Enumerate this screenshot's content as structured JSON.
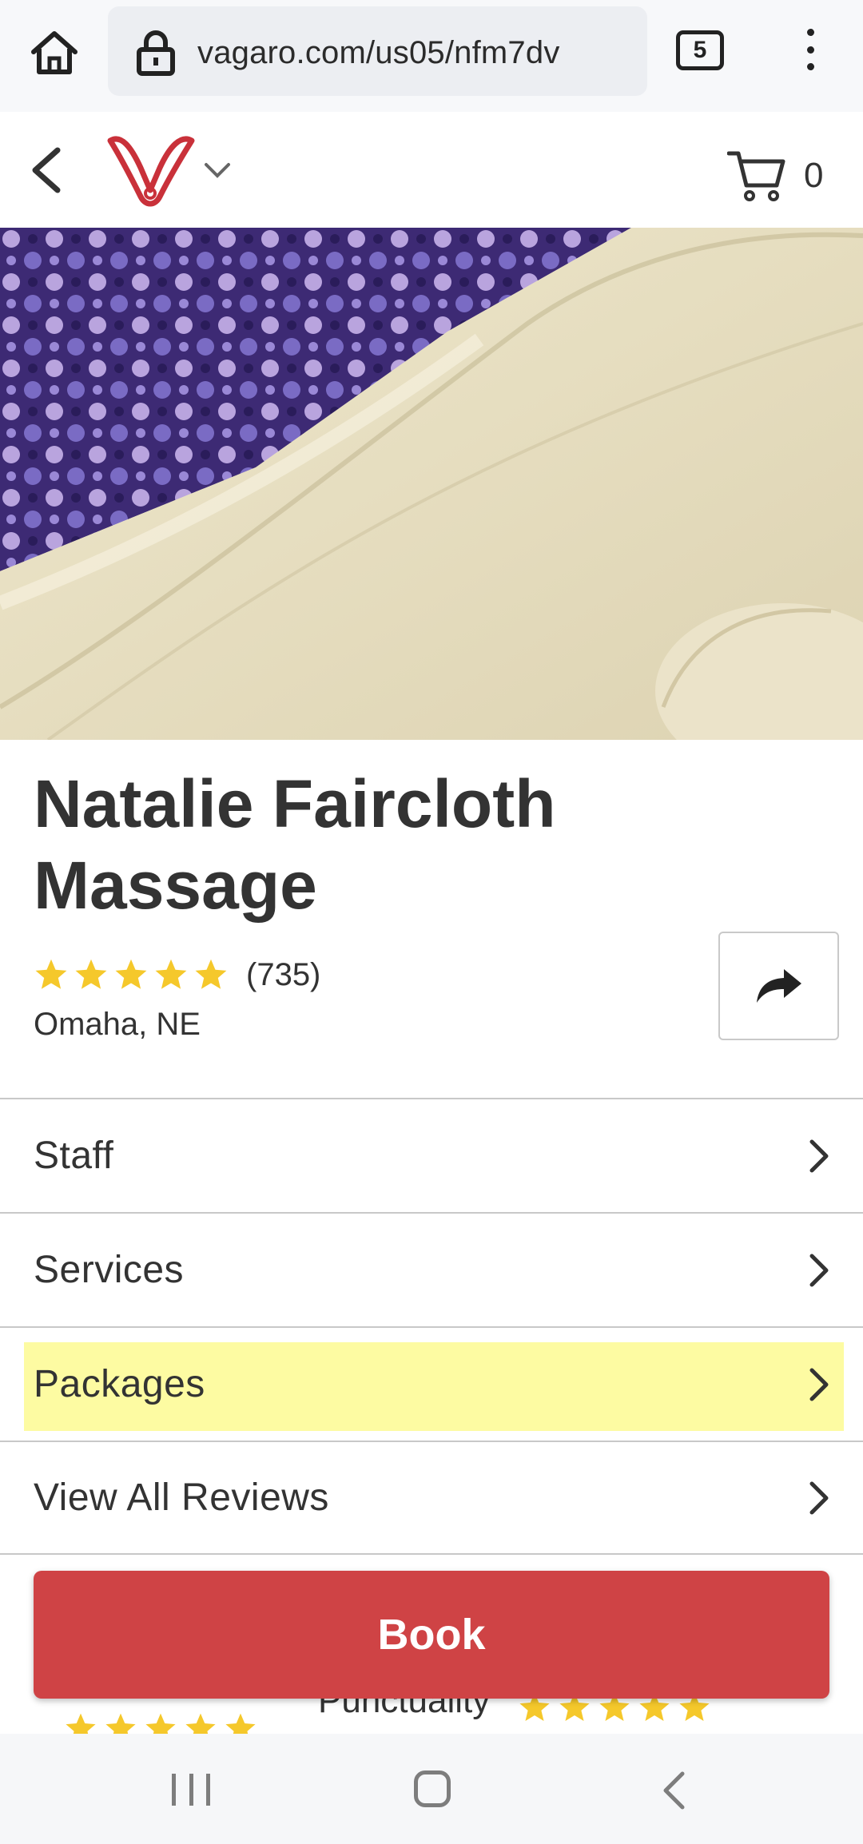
{
  "browser": {
    "url": "vagaro.com/us05/nfm7dv",
    "tab_count": "5"
  },
  "header": {
    "cart_count": "0"
  },
  "business": {
    "name": "Natalie Faircloth Massage",
    "rating": 5,
    "review_count": "(735)",
    "location": "Omaha, NE"
  },
  "menu": {
    "items": [
      {
        "label": "Staff"
      },
      {
        "label": "Services"
      },
      {
        "label": "Packages"
      },
      {
        "label": "View All Reviews"
      }
    ]
  },
  "peek": {
    "label": "Punctuality"
  },
  "actions": {
    "book_label": "Book"
  },
  "colors": {
    "brand_red": "#cf4345",
    "star_yellow": "#f5c82b",
    "highlight": "#fdfba2"
  }
}
